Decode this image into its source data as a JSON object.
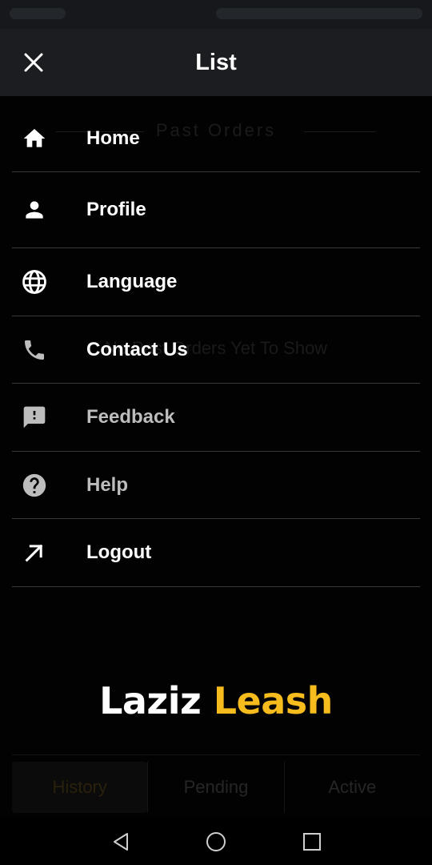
{
  "drawer": {
    "title": "List",
    "close_icon": "close-icon"
  },
  "menu": [
    {
      "label": "Home",
      "icon": "home-icon",
      "enabled": true
    },
    {
      "label": "Profile",
      "icon": "person-icon",
      "enabled": true
    },
    {
      "label": "Language",
      "icon": "globe-icon",
      "enabled": true
    },
    {
      "label": "Contact Us",
      "icon": "phone-icon",
      "enabled": true
    },
    {
      "label": "Feedback",
      "icon": "feedback-icon",
      "enabled": false
    },
    {
      "label": "Help",
      "icon": "help-icon",
      "enabled": false
    },
    {
      "label": "Logout",
      "icon": "arrow-up-right-icon",
      "enabled": true
    }
  ],
  "brand": {
    "word1": "Laziz",
    "word2": "Leash",
    "color1": "#ffffff",
    "color2": "#f6bb1d"
  },
  "background_screen": {
    "heading": "Past Orders",
    "empty_message": "No Past Orders Yet To Show",
    "tabs": [
      "History",
      "Pending",
      "Active"
    ],
    "active_tab": "History"
  },
  "nav_bar": {
    "back_icon": "back-triangle-icon",
    "home_icon": "home-circle-icon",
    "recents_icon": "recents-square-icon"
  }
}
